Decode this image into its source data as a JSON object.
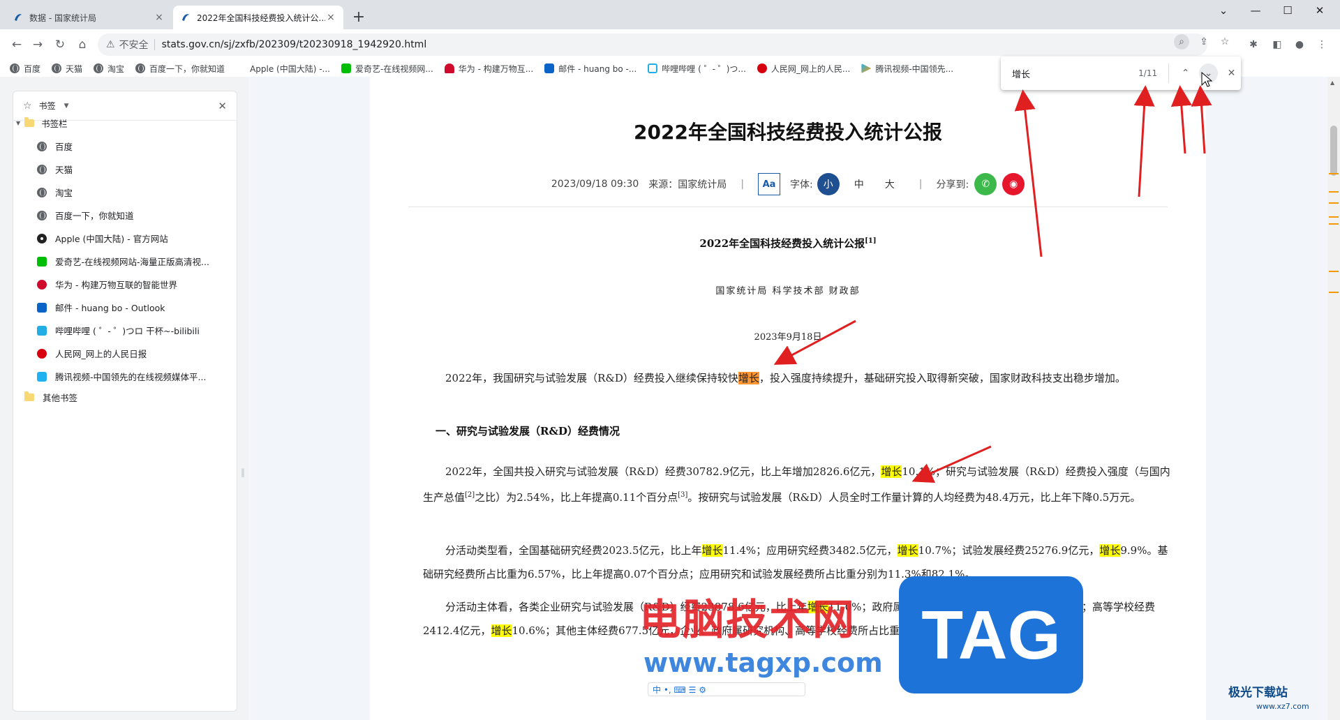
{
  "tabs": [
    {
      "title": "数据 - 国家统计局",
      "close": "×"
    },
    {
      "title": "2022年全国科技经费投入统计公...",
      "close": "×"
    }
  ],
  "new_tab": "+",
  "window_controls": {
    "dropdown": "⌄",
    "minimize": "—",
    "maximize": "☐",
    "close": "✕"
  },
  "toolbar": {
    "back": "←",
    "forward": "→",
    "reload": "↻",
    "home": "⌂",
    "insecure_label": "不安全",
    "url": "stats.gov.cn/sj/zxfb/202309/t20230918_1942920.html"
  },
  "bookmarks_bar": [
    {
      "label": "百度",
      "icon": "globe-icon"
    },
    {
      "label": "天猫",
      "icon": "globe-icon"
    },
    {
      "label": "淘宝",
      "icon": "globe-icon"
    },
    {
      "label": "百度一下，你就知道",
      "icon": "globe-icon"
    },
    {
      "label": "Apple (中国大陆) -...",
      "icon": "apple-icon"
    },
    {
      "label": "爱奇艺-在线视频网...",
      "icon": "iqiyi-icon"
    },
    {
      "label": "华为 - 构建万物互...",
      "icon": "huawei-icon"
    },
    {
      "label": "邮件 - huang bo -...",
      "icon": "outlook-icon"
    },
    {
      "label": "哔哩哔哩 ( ゜- ゜)つ...",
      "icon": "bilibili-icon"
    },
    {
      "label": "人民网_网上的人民...",
      "icon": "people-icon"
    },
    {
      "label": "腾讯视频-中国领先...",
      "icon": "tencent-video-icon"
    }
  ],
  "side_panel": {
    "header": "书签",
    "root_folder": "书签栏",
    "items": [
      {
        "label": "百度",
        "icon": "globe-icon",
        "color": "#5f6368"
      },
      {
        "label": "天猫",
        "icon": "globe-icon",
        "color": "#5f6368"
      },
      {
        "label": "淘宝",
        "icon": "globe-icon",
        "color": "#5f6368"
      },
      {
        "label": "百度一下，你就知道",
        "icon": "globe-icon",
        "color": "#5f6368"
      },
      {
        "label": "Apple (中国大陆) - 官方网站",
        "icon": "apple-icon",
        "color": "#222222"
      },
      {
        "label": "爱奇艺-在线视频网站-海量正版高清视...",
        "icon": "iqiyi-icon",
        "color": "#00be06"
      },
      {
        "label": "华为 - 构建万物互联的智能世界",
        "icon": "huawei-icon",
        "color": "#cf0a2c"
      },
      {
        "label": "邮件 - huang bo - Outlook",
        "icon": "outlook-icon",
        "color": "#0a64c8"
      },
      {
        "label": "哔哩哔哩 ( ゜- ゜)つロ 干杯~-bilibili",
        "icon": "bilibili-icon",
        "color": "#23ade5"
      },
      {
        "label": "人民网_网上的人民日报",
        "icon": "people-icon",
        "color": "#d7000f"
      },
      {
        "label": "腾讯视频-中国领先的在线视频媒体平...",
        "icon": "tencent-video-icon",
        "color": "#20b2f0"
      }
    ],
    "other_folder": "其他书签"
  },
  "article": {
    "title": "2022年全国科技经费投入统计公报",
    "meta": {
      "datetime": "2023/09/18 09:30",
      "source": "来源：国家统计局",
      "font_toggle": "Aa",
      "font_label": "字体:",
      "sizes": [
        "小",
        "中",
        "大"
      ],
      "share_label": "分享到:"
    },
    "subtitle": "2022年全国科技经费投入统计公报",
    "subtitle_sup": "[1]",
    "authors": "国家统计局  科学技术部  财政部",
    "date": "2023年9月18日",
    "p1": {
      "a": "2022年，我国研究与试验发展（R&D）经费投入继续保持较快",
      "hl": "增长",
      "b": "，投入强度持续提升，基础研究投入取得新突破，国家财政科技支出稳步增加。"
    },
    "section1": "一、研究与试验发展（R&D）经费情况",
    "p2": {
      "a": "2022年，全国共投入研究与试验发展（R&D）经费30782.9亿元，比上年增加2826.6亿元，",
      "hl": "增长",
      "b": "10.1%；研究与试验发展（R&D）经费投入强度（与国内生产总值",
      "sup1": "[2]",
      "c": "之比）为2.54%，比上年提高0.11个百分点",
      "sup2": "[3]",
      "d": "。按研究与试验发展（R&D）人员全时工作量计算的人均经费为48.4万元，比上年下降0.5万元。"
    },
    "p3": {
      "a": "分活动类型看，全国基础研究经费2023.5亿元，比上年",
      "hl1": "增长",
      "b": "11.4%；应用研究经费3482.5亿元，",
      "hl2": "增长",
      "c": "10.7%；试验发展经费25276.9亿元，",
      "hl3": "增长",
      "d": "9.9%。基础研究经费所占比重为6.57%，比上年提高0.07个百分点；应用研究和试验发展经费所占比重分别为11.3%和82.1%。"
    },
    "p4": {
      "a": "分活动主体看，各类企业研究与试验发展（R&D）经费23878.6亿元，比上年",
      "hl1": "增长",
      "b": "11.0%；政府属研究机构经费3814.4亿元，",
      "hl2": "增长",
      "c": "4.6%；高等学校经费2412.4亿元，",
      "hl3": "增长",
      "d": "10.6%；其他主体经费677.5亿元，企业、政府属研究机构、高等学校经费所占比重分别为77.6%、12.4%和7.8%。"
    }
  },
  "find_bar": {
    "query": "增长",
    "count": "1/11",
    "prev": "⌃",
    "next": "⌄",
    "close": "✕"
  },
  "watermarks": {
    "red_text": "电脑技术网",
    "url": "www.tagxp.com",
    "tag": "TAG",
    "corner_title": "极光下载站",
    "corner_url": "www.xz7.com",
    "ime": "中 •, ⌨ ☰ ⚙"
  },
  "colors": {
    "highlight": "#ffff00",
    "current_highlight": "#ff9632",
    "annotation_arrow": "#e02020",
    "accent_blue": "#1d4f91"
  }
}
